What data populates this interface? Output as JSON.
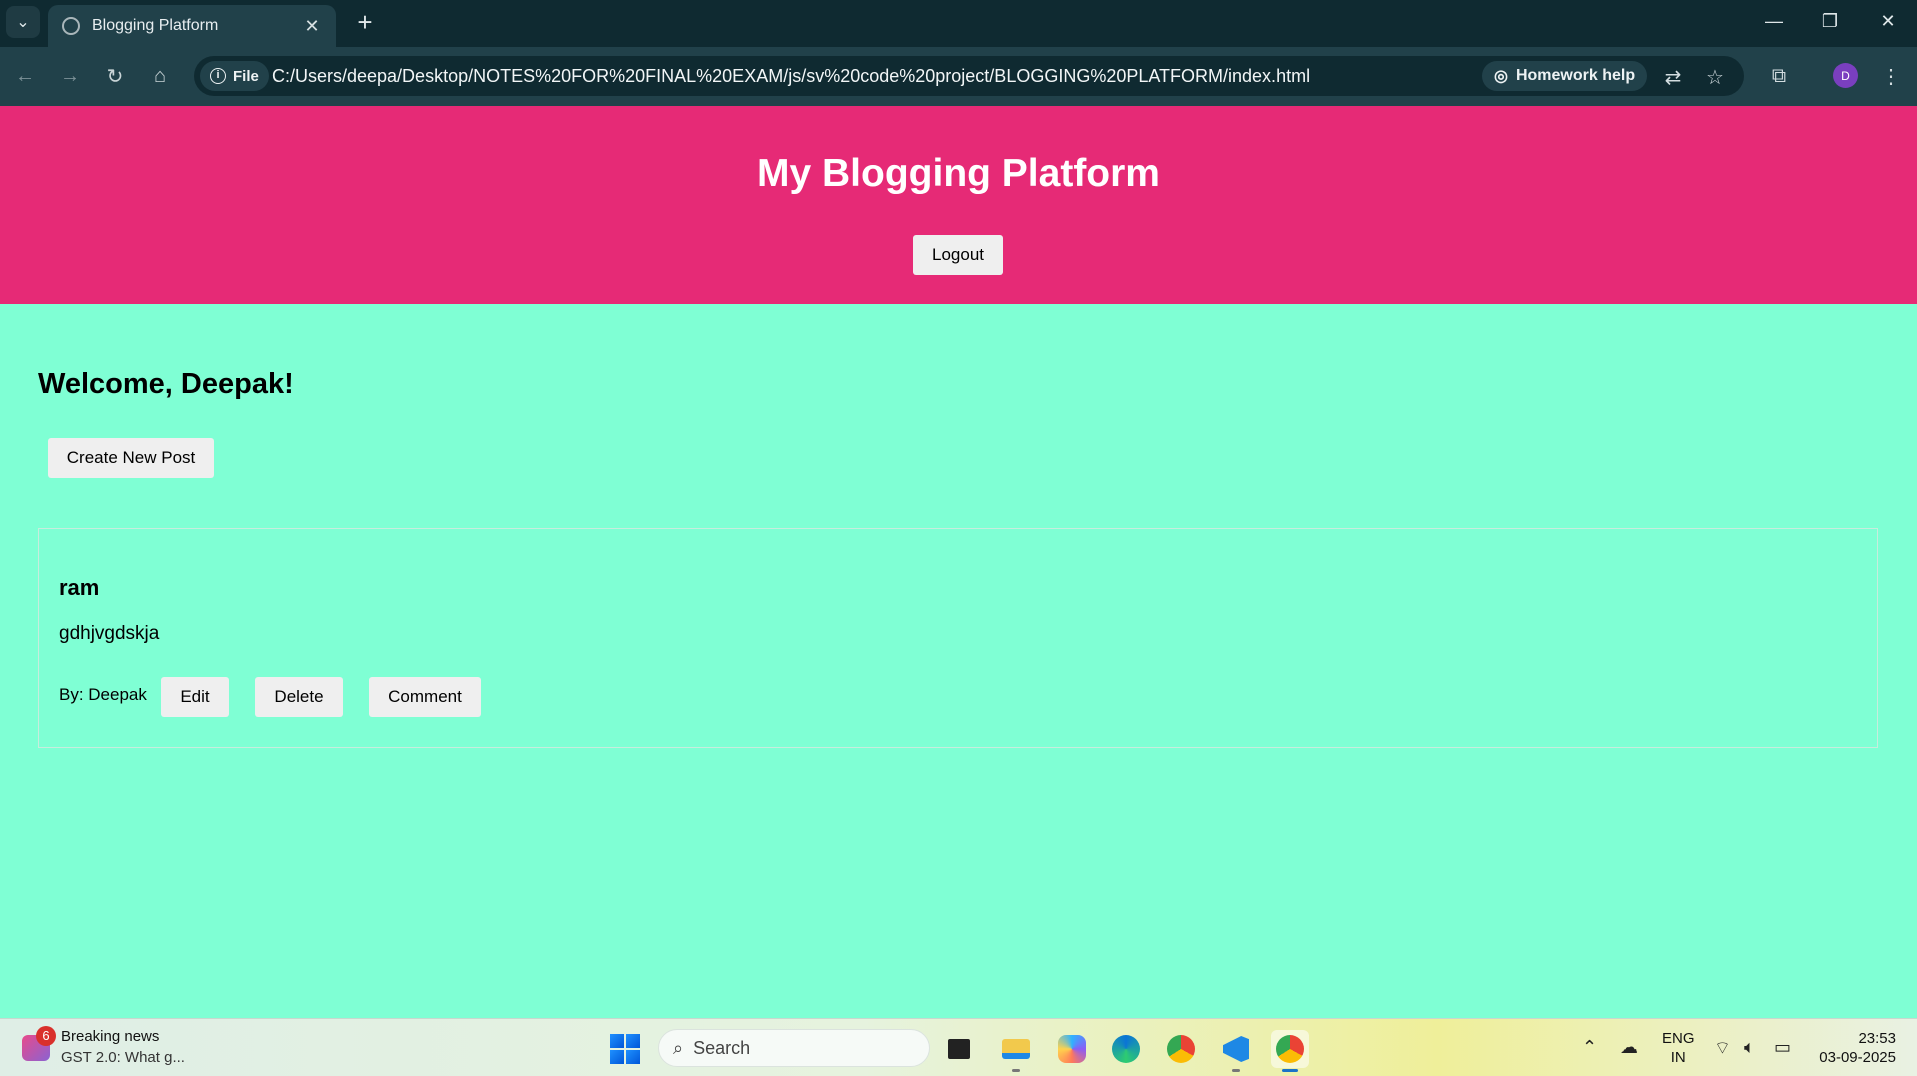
{
  "browser": {
    "tab_title": "Blogging Platform",
    "site_chip": "File",
    "url": "C:/Users/deepa/Desktop/NOTES%20FOR%20FINAL%20EXAM/js/sv%20code%20project/BLOGGING%20PLATFORM/index.html",
    "homework_help": "Homework help",
    "profile_initial": "D"
  },
  "header": {
    "title": "My Blogging Platform",
    "logout_label": "Logout"
  },
  "main": {
    "welcome": "Welcome, Deepak!",
    "create_label": "Create New Post",
    "posts": [
      {
        "title": "ram",
        "body": "gdhjvgdskja",
        "author_line": "By: Deepak",
        "edit_label": "Edit",
        "delete_label": "Delete",
        "comment_label": "Comment"
      }
    ]
  },
  "taskbar": {
    "news_badge": "6",
    "news_title": "Breaking news",
    "news_sub": "GST 2.0: What g...",
    "search_placeholder": "Search",
    "lang_top": "ENG",
    "lang_bottom": "IN",
    "time": "23:53",
    "date": "03-09-2025"
  },
  "colors": {
    "header_bg": "#e62a76",
    "page_bg": "#7fffd4",
    "browser_dark": "#0f2a31"
  }
}
